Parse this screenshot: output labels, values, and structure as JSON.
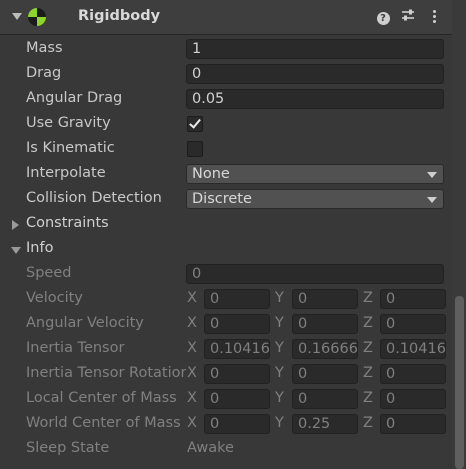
{
  "component": {
    "title": "Rigidbody",
    "enabled": true,
    "icons": {
      "fold": "chevron-down-icon",
      "component": "rigidbody-icon",
      "help": "help-icon",
      "presets": "presets-icon",
      "menu": "kebab-menu-icon"
    },
    "colors": {
      "icon_green": "#8fd42a",
      "background": "#383838",
      "field": "#2a2a2a"
    }
  },
  "properties": {
    "mass": {
      "label": "Mass",
      "value": "1"
    },
    "drag": {
      "label": "Drag",
      "value": "0"
    },
    "angular_drag": {
      "label": "Angular Drag",
      "value": "0.05"
    },
    "use_gravity": {
      "label": "Use Gravity",
      "checked": true
    },
    "is_kinematic": {
      "label": "Is Kinematic",
      "checked": false
    },
    "interpolate": {
      "label": "Interpolate",
      "value": "None"
    },
    "collision_detection": {
      "label": "Collision Detection",
      "value": "Discrete"
    }
  },
  "constraints": {
    "label": "Constraints",
    "expanded": false
  },
  "info": {
    "label": "Info",
    "expanded": true,
    "speed": {
      "label": "Speed",
      "value": "0"
    },
    "velocity": {
      "label": "Velocity",
      "x": "0",
      "y": "0",
      "z": "0"
    },
    "angular_velocity": {
      "label": "Angular Velocity",
      "x": "0",
      "y": "0",
      "z": "0"
    },
    "inertia_tensor": {
      "label": "Inertia Tensor",
      "x": "0.10416",
      "y": "0.16666",
      "z": "0.10416"
    },
    "inertia_tensor_rotation": {
      "label": "Inertia Tensor Rotation",
      "x": "0",
      "y": "0",
      "z": "0"
    },
    "local_center_of_mass": {
      "label": "Local Center of Mass",
      "x": "0",
      "y": "0",
      "z": "0"
    },
    "world_center_of_mass": {
      "label": "World Center of Mass",
      "x": "0",
      "y": "0.25",
      "z": "0"
    },
    "sleep_state": {
      "label": "Sleep State",
      "value": "Awake"
    }
  },
  "axes": {
    "x": "X",
    "y": "Y",
    "z": "Z"
  }
}
